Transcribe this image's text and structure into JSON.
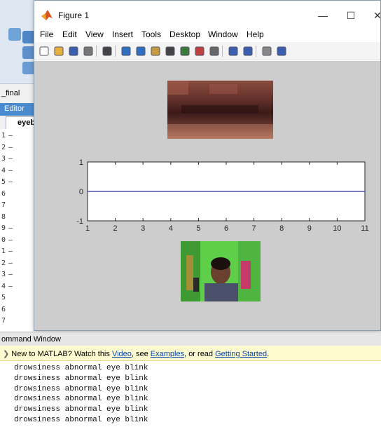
{
  "background": {
    "filename_fragment": "_final",
    "editor_tab": "Editor",
    "file_tab": "eyeb",
    "line_numbers": [
      "1",
      "2",
      "3",
      "4",
      "5",
      "6",
      "7",
      "8",
      "9",
      "0",
      "1",
      "2",
      "3",
      "4",
      "5",
      "6",
      "7"
    ],
    "line_marks": [
      "–",
      "–",
      "–",
      "–",
      "–",
      "",
      "",
      "",
      "–",
      "–",
      "–",
      "–",
      "–",
      "–",
      "",
      "",
      ""
    ]
  },
  "figure": {
    "title": "Figure 1",
    "window_controls": {
      "minimize": "—",
      "maximize": "☐",
      "close": "✕"
    },
    "menu": [
      "File",
      "Edit",
      "View",
      "Insert",
      "Tools",
      "Desktop",
      "Window",
      "Help"
    ],
    "toolbar_icons": [
      "new-figure-icon",
      "open-file-icon",
      "save-icon",
      "print-icon",
      "pointer-icon",
      "zoom-in-icon",
      "zoom-out-icon",
      "pan-icon",
      "rotate-icon",
      "data-cursor-icon",
      "brush-icon",
      "link-icon",
      "colorbar-icon",
      "legend-icon",
      "hide-plot-tools-icon",
      "show-plot-tools-icon"
    ]
  },
  "chart_data": {
    "type": "line",
    "x": [
      1,
      2,
      3,
      4,
      5,
      6,
      7,
      8,
      9,
      10,
      11
    ],
    "series": [
      {
        "values": [
          0,
          0,
          0,
          0,
          0,
          0,
          0,
          0,
          0,
          0,
          0
        ],
        "color": "#2a2fa0"
      }
    ],
    "title": "",
    "xlabel": "",
    "ylabel": "",
    "xlim": [
      1,
      11
    ],
    "ylim": [
      -1,
      1
    ],
    "xticks": [
      "1",
      "2",
      "3",
      "4",
      "5",
      "6",
      "7",
      "8",
      "9",
      "10",
      "11"
    ],
    "yticks": [
      "-1",
      "0",
      "1"
    ],
    "grid": false
  },
  "command_window": {
    "title": "ommand Window",
    "banner": {
      "prefix": "New to MATLAB? Watch this ",
      "video": "Video",
      "sep1": ", see ",
      "examples": "Examples",
      "sep2": ", or read ",
      "getting_started": "Getting Started",
      "suffix": "."
    },
    "lines": [
      "drowsiness abnormal eye blink",
      "drowsiness abnormal eye blink",
      "drowsiness abnormal eye blink",
      "drowsiness abnormal eye blink",
      "drowsiness abnormal eye blink",
      "drowsiness abnormal eye blink"
    ]
  },
  "colors": {
    "figure_bg": "#cdcdcd",
    "axes_bg": "#ffffff",
    "line": "#2a2fa0",
    "banner_bg": "#fffbd0",
    "editor_tab": "#4a8bd0"
  }
}
